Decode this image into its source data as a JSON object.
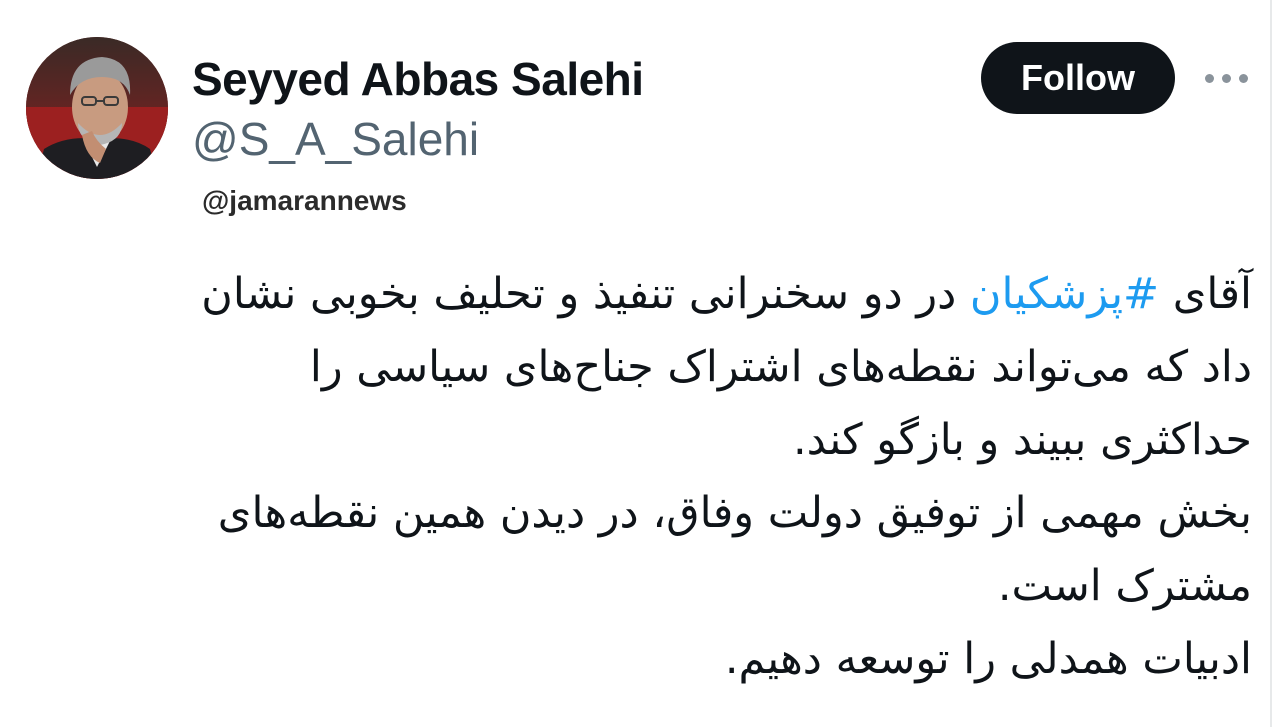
{
  "author": {
    "display_name": "Seyyed Abbas Salehi",
    "handle": "@S_A_Salehi"
  },
  "watermark": "@jamarannews",
  "actions": {
    "follow_label": "Follow",
    "more_icon": "more-horizontal-icon"
  },
  "tweet": {
    "line1_before": "آقای ",
    "hashtag": "#پزشکیان",
    "line1_after": " در دو سخنرانی تنفیذ و تحلیف بخوبی نشان",
    "line2": "داد که می‌تواند نقطه‌های اشتراک جناح‌های سیاسی را",
    "line3": "حداکثری ببیند و بازگو کند.",
    "line4": "بخش مهمی از توفیق دولت وفاق، در دیدن همین نقطه‌های",
    "line5": "مشترک است.",
    "line6": "ادبیات همدلی را توسعه دهیم."
  },
  "colors": {
    "hashtag": "#1d9bf0",
    "follow_bg": "#0f1419",
    "handle": "#536471"
  }
}
